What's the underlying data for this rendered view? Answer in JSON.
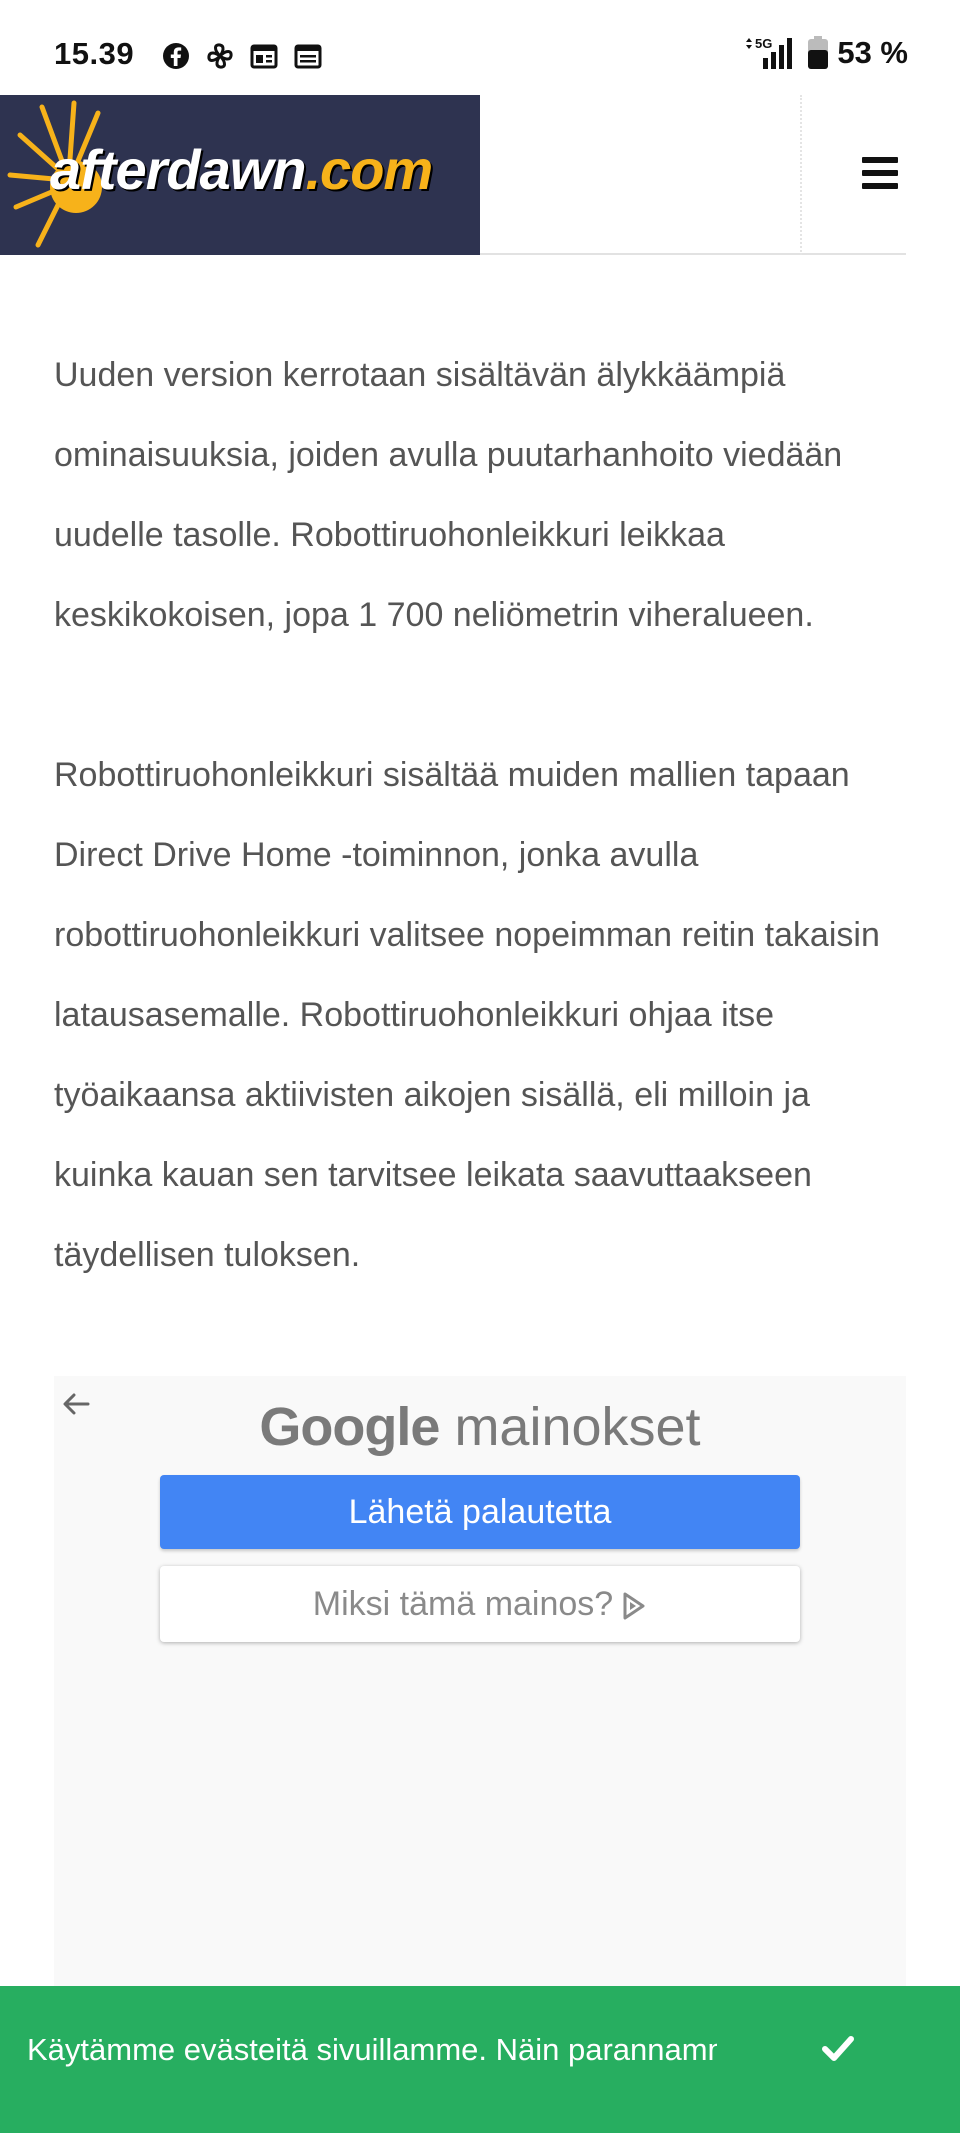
{
  "status_bar": {
    "time": "15.39",
    "notification_icons": [
      "facebook-icon",
      "pinwheel-icon",
      "news-icon",
      "news-icon"
    ],
    "network": "5G",
    "battery_percent": "53 %"
  },
  "header": {
    "logo_text_main": "afterdawn",
    "logo_text_domain": ".com",
    "menu_icon": "hamburger-menu-icon"
  },
  "article": {
    "paragraphs": [
      "Uuden version kerrotaan sisältävän älykkäämpiä ominaisuuksia, joiden avulla puutarhanhoito viedään uudelle tasolle. Robottiruohonleikkuri leikkaa keskikokoisen, jopa 1 700 neliömetrin viheralueen.",
      "Robottiruohonleikkuri sisältää muiden mallien tapaan Direct Drive Home -toiminnon, jonka avulla robottiruohonleikkuri valitsee nopeimman reitin takaisin latausasemalle. Robottiruohonleikkuri ohjaa itse työaikaansa aktiivisten aikojen sisällä, eli milloin ja kuinka kauan sen tarvitsee leikata saavuttaakseen täydellisen tuloksen."
    ]
  },
  "ad": {
    "brand_google": "Google",
    "brand_suffix": "mainokset",
    "feedback_button": "Lähetä palautetta",
    "why_button": "Miksi tämä mainos?",
    "colors": {
      "feedback_bg": "#4285f4",
      "panel_bg": "#f9f9f9"
    }
  },
  "cookie_banner": {
    "text": "Käytämme evästeitä sivuillamme. Näin parannamme",
    "color": "#27ae60"
  }
}
